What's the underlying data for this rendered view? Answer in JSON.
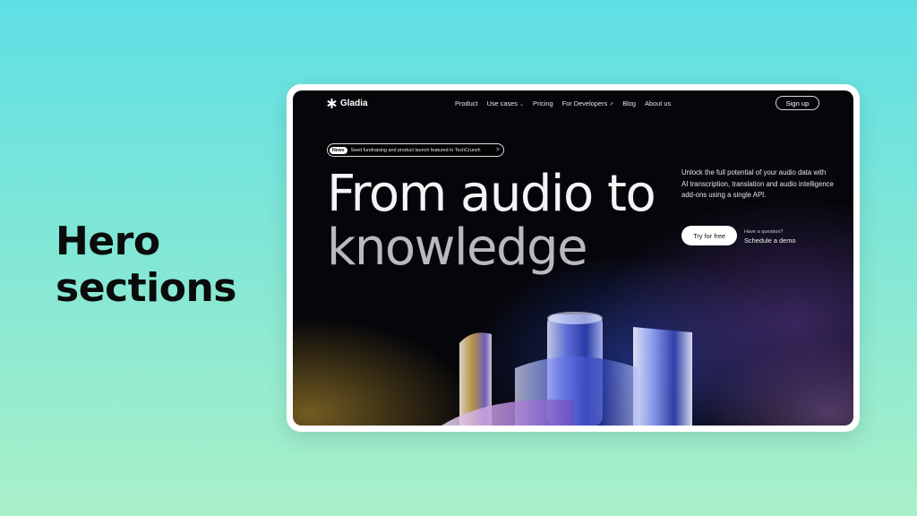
{
  "slide": {
    "title_line1": "Hero",
    "title_line2": "sections"
  },
  "nav": {
    "logo": "Gladia",
    "items": [
      {
        "label": "Product"
      },
      {
        "label": "Use cases"
      },
      {
        "label": "Pricing"
      },
      {
        "label": "For Developers"
      },
      {
        "label": "Blog"
      },
      {
        "label": "About us"
      }
    ],
    "signup": "Sign up"
  },
  "news": {
    "badge": "News",
    "text": "Seed fundraising and product launch featured in TechCrunch",
    "arrow": ">"
  },
  "hero": {
    "title_line1": "From audio to",
    "title_line2": "knowledge",
    "description": "Unlock the full potential of your audio data with AI transcription, translation and audio intelligence add-ons using a single API.",
    "cta_primary": "Try for free",
    "question": "Have a question?",
    "cta_secondary": "Schedule a demo"
  },
  "icons": {
    "logo": "gladia-asterisk-icon",
    "dropdown": "chevron-down-icon",
    "external": "external-link-icon",
    "arrow": "chevron-right-icon"
  },
  "colors": {
    "page_bg_top": "#5fe0e6",
    "page_bg_bottom": "#a9f0c9",
    "screen_bg": "#06060a",
    "text_primary": "#f4f4f6"
  }
}
